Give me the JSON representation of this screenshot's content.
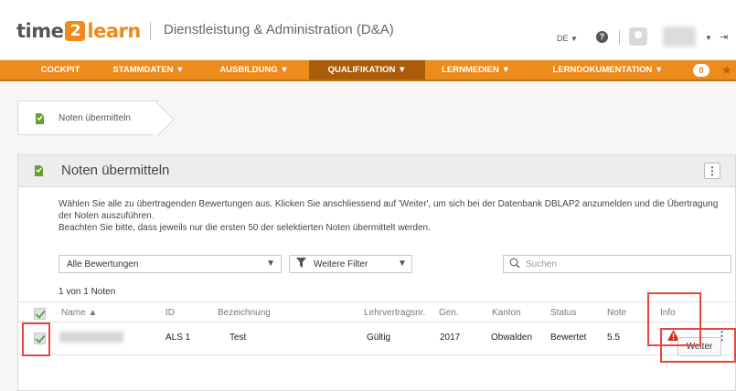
{
  "header": {
    "logo_time": "time",
    "logo_two": "2",
    "logo_learn": "learn",
    "app_title": "Dienstleistung & Administration (D&A)",
    "language": "DE",
    "help_glyph": "?",
    "logout_glyph": "⇥"
  },
  "nav": {
    "items": [
      {
        "label": "COCKPIT"
      },
      {
        "label": "STAMMDATEN ▼"
      },
      {
        "label": "AUSBILDUNG ▼"
      },
      {
        "label": "QUALIFIKATION ▼"
      },
      {
        "label": "LERNMEDIEN ▼"
      },
      {
        "label": "LERNDOKUMENTATION ▼"
      }
    ],
    "active": "QUALIFIKATION",
    "badge": "0"
  },
  "breadcrumb": {
    "label": "Noten übermitteln"
  },
  "panel": {
    "title": "Noten übermitteln",
    "menu_glyph": "⋮",
    "description_1": "Wählen Sie alle zu übertragenden Bewertungen aus. Klicken Sie anschliessend auf 'Weiter', um sich bei der Datenbank DBLAP2 anzumelden und die Übertragung der Noten auszuführen.",
    "description_2": "Beachten Sie bitte, dass jeweils nur die ersten 50 der selektierten Noten übermittelt werden.",
    "filter_select": "Alle Bewertungen",
    "more_filter": "Weitere Filter",
    "search_placeholder": "Suchen",
    "count": "1 von 1 Noten",
    "columns": {
      "name": "Name ▲",
      "id": "ID",
      "bezeichnung": "Bezeichnung",
      "lehrvertragsnr": "Lehrvertragsnr.",
      "gen": "Gen.",
      "kanton": "Kanton",
      "status": "Status",
      "note": "Note",
      "info": "Info"
    },
    "rows": [
      {
        "id": "ALS 1",
        "bezeichnung": "Test",
        "lehrvertragsnr": "Gültig",
        "gen": "2017",
        "kanton": "Obwalden",
        "status": "Bewertet",
        "note": "5.5"
      }
    ],
    "weiter_label": "Weiter"
  },
  "colors": {
    "brand_orange": "#ed8b1d",
    "nav_active": "#ab5c08",
    "highlight_red": "#e8463f",
    "check_green": "#5aa84a",
    "warning_red": "#d9261c"
  },
  "icons": [
    "help-icon",
    "avatar-icon",
    "logout-icon",
    "star-icon",
    "document-icon",
    "filter-icon",
    "search-icon",
    "warning-icon",
    "kebab-icon",
    "checkbox-icon"
  ]
}
